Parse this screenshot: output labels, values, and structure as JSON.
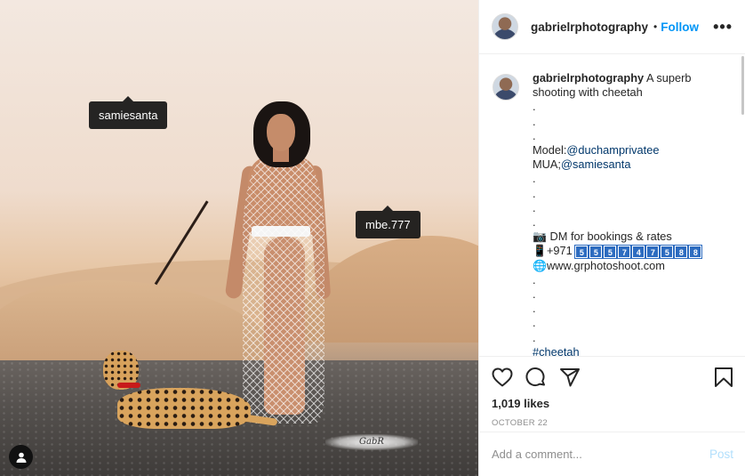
{
  "photo": {
    "tags": [
      "samiesanta",
      "mbe.777"
    ],
    "watermark": "GabR"
  },
  "header": {
    "username": "gabrielrphotography",
    "separator": "•",
    "follow_label": "Follow",
    "more_icon": "ellipsis-icon"
  },
  "caption": {
    "username": "gabrielrphotography",
    "text_first": "A superb shooting with cheetah",
    "dots_a": [
      ".",
      ".",
      "."
    ],
    "model_label": "Model:",
    "model_mention": "@duchamprivatee",
    "mua_label": "MUA;",
    "mua_mention": "@samiesanta",
    "dots_b": [
      ".",
      ".",
      ".",
      "."
    ],
    "camera_line": "DM for bookings & rates",
    "phone_prefix": "+971",
    "phone_digits": [
      "5",
      "5",
      "5",
      "7",
      "4",
      "7",
      "5",
      "8",
      "8"
    ],
    "website": "www.grphotoshoot.com",
    "dots_c": [
      ".",
      ".",
      ".",
      ".",
      "."
    ],
    "hashtag": "#cheetah"
  },
  "actions": {
    "likes": "1,019 likes",
    "date": "OCTOBER 22"
  },
  "comment_box": {
    "placeholder": "Add a comment...",
    "post_label": "Post"
  },
  "colors": {
    "accent": "#0095f6",
    "mention": "#00376b",
    "post_disabled": "#b2dffc",
    "muted": "#8e8e8e"
  }
}
